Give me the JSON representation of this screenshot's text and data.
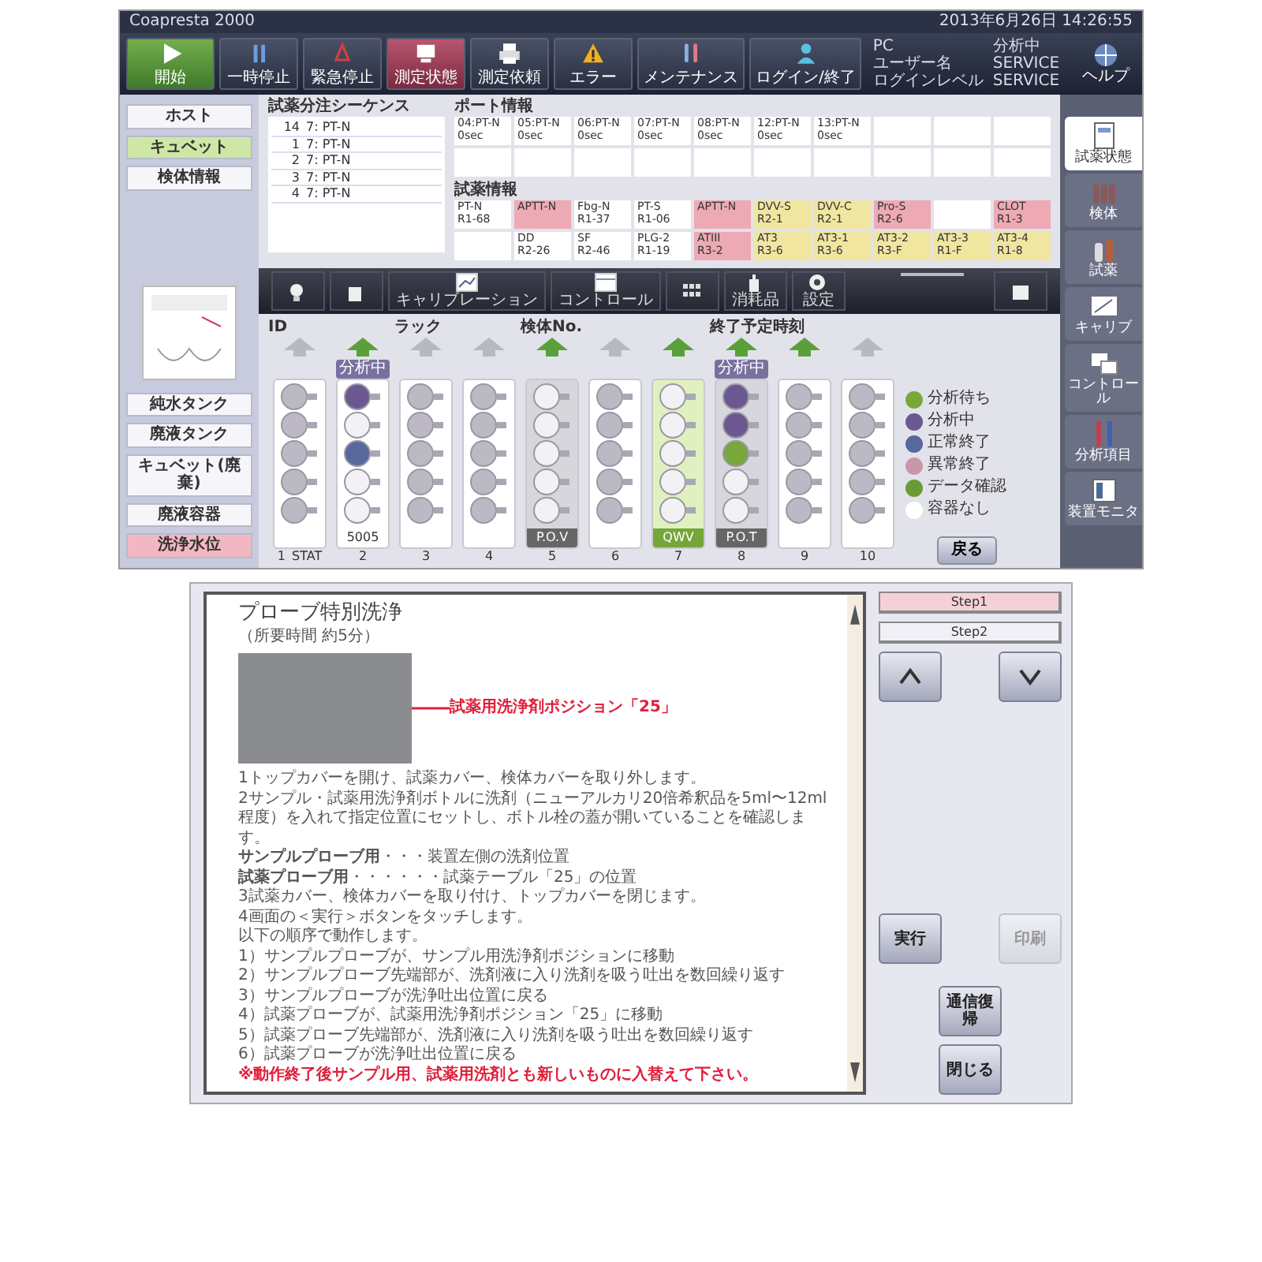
{
  "app": {
    "title": "Coapresta 2000",
    "datetime": "2013年6月26日 14:26:55"
  },
  "toolbar": [
    {
      "kind": "start",
      "label": "開始",
      "selected": false
    },
    {
      "kind": "normal",
      "label": "一時停止",
      "selected": false
    },
    {
      "kind": "normal",
      "label": "緊急停止",
      "selected": false
    },
    {
      "kind": "normal",
      "label": "測定状態",
      "selected": true
    },
    {
      "kind": "normal",
      "label": "測定依頼",
      "selected": false
    },
    {
      "kind": "normal",
      "label": "エラー",
      "selected": false
    },
    {
      "kind": "normal",
      "label": "メンテナンス",
      "selected": false
    },
    {
      "kind": "normal",
      "label": "ログイン/終了",
      "selected": false
    }
  ],
  "status": [
    {
      "label": "PC",
      "value": "分析中"
    },
    {
      "label": "ユーザー名",
      "value": "SERVICE"
    },
    {
      "label": "ログインレベル",
      "value": "SERVICE"
    }
  ],
  "help": "ヘルプ",
  "sidebar": {
    "top_buttons": [
      {
        "label": "ホスト",
        "selected": false
      },
      {
        "label": "キュベット",
        "selected": true
      },
      {
        "label": "検体情報",
        "selected": false
      }
    ],
    "bottom_buttons": [
      {
        "label": "純水タンク",
        "warning": false
      },
      {
        "label": "廃液タンク",
        "warning": false
      },
      {
        "label": "キュベット(廃棄)",
        "warning": false
      },
      {
        "label": "廃液容器",
        "warning": false
      },
      {
        "label": "洗浄水位",
        "warning": true
      }
    ]
  },
  "sequence": {
    "title": "試薬分注シーケンス",
    "rows": [
      {
        "no": "14",
        "item": "7: PT-N"
      },
      {
        "no": "1",
        "item": "7: PT-N"
      },
      {
        "no": "2",
        "item": "7: PT-N"
      },
      {
        "no": "3",
        "item": "7: PT-N"
      },
      {
        "no": "4",
        "item": "7: PT-N"
      }
    ]
  },
  "ports": {
    "title": "ポート情報",
    "cells": [
      {
        "name": "04:PT-N",
        "time": "0sec"
      },
      {
        "name": "05:PT-N",
        "time": "0sec"
      },
      {
        "name": "06:PT-N",
        "time": "0sec"
      },
      {
        "name": "07:PT-N",
        "time": "0sec"
      },
      {
        "name": "08:PT-N",
        "time": "0sec"
      },
      {
        "name": "12:PT-N",
        "time": "0sec"
      },
      {
        "name": "13:PT-N",
        "time": "0sec"
      }
    ]
  },
  "reagents": {
    "title": "試薬情報",
    "cells": [
      {
        "name": "PT-N",
        "pos": "R1-68",
        "color": "#ffffff"
      },
      {
        "name": "APTT-N",
        "color": "#eeaab4"
      },
      {
        "name": "Fbg-N",
        "pos": "R1-37",
        "color": "#ffffff"
      },
      {
        "name": "PT-S",
        "pos": "R1-06",
        "color": "#ffffff"
      },
      {
        "name": "APTT-N",
        "color": "#eeaab4"
      },
      {
        "name": "DVV-S",
        "pos": "R2-1",
        "color": "#f0e6a0"
      },
      {
        "name": "DVV-C",
        "pos": "R2-1",
        "color": "#f0e6a0"
      },
      {
        "name": "Pro-S",
        "pos": "R2-6",
        "color": "#eeaab4"
      },
      {
        "color": "#ffffff"
      },
      {
        "name": "CLOT",
        "pos": "R1-3",
        "color": "#eeaab4"
      },
      {
        "color": "#ffffff"
      },
      {
        "name": "DD",
        "pos": "R2-26",
        "color": "#ffffff"
      },
      {
        "name": "SF",
        "pos": "R2-46",
        "color": "#ffffff"
      },
      {
        "name": "PLG-2",
        "pos": "R1-19",
        "color": "#ffffff"
      },
      {
        "name": "ATIII",
        "pos": "R3-2",
        "color": "#eeaab4"
      },
      {
        "name": "AT3",
        "pos": "R3-6",
        "color": "#f0e6a0"
      },
      {
        "name": "AT3-1",
        "pos": "R3-6",
        "color": "#f0e6a0"
      },
      {
        "name": "AT3-2",
        "pos": "R3-F",
        "color": "#f0e6a0"
      },
      {
        "name": "AT3-3",
        "pos": "R1-F",
        "color": "#f0e6a0"
      },
      {
        "name": "AT3-4",
        "pos": "R1-8",
        "color": "#f0e6a0"
      }
    ]
  },
  "tools": [
    {
      "kind": "icon"
    },
    {
      "kind": "icon"
    },
    {
      "kind": "labeled",
      "label": "キャリブレーション"
    },
    {
      "kind": "labeled",
      "label": "コントロール"
    },
    {
      "kind": "icon"
    },
    {
      "kind": "labeled",
      "label": "消耗品"
    },
    {
      "kind": "labeled",
      "label": "設定"
    }
  ],
  "rack_header": [
    "ID",
    "ラック",
    "検体No.",
    "終了予定時刻"
  ],
  "racks": [
    {
      "number": "1",
      "tag": "STAT",
      "arrow_on": false,
      "kind": "empty",
      "cups": [
        {
          "color": "#bdb9c4"
        },
        {
          "color": "#bdb9c4"
        },
        {
          "color": "#bdb9c4"
        },
        {
          "color": "#bdb9c4"
        },
        {
          "color": "#bdb9c4"
        }
      ]
    },
    {
      "number": "2",
      "arrow_on": true,
      "badge": "分析中",
      "kind": "empty",
      "label": "5005",
      "cups": [
        {
          "color": "#6c5890"
        },
        {
          "color": "#f2f2f4"
        },
        {
          "color": "#56689c"
        },
        {
          "color": "#f2f2f4"
        },
        {
          "color": "#f2f2f4"
        }
      ]
    },
    {
      "number": "3",
      "arrow_on": false,
      "kind": "empty",
      "cups": [
        {
          "color": "#bdb9c4"
        },
        {
          "color": "#bdb9c4"
        },
        {
          "color": "#bdb9c4"
        },
        {
          "color": "#bdb9c4"
        },
        {
          "color": "#bdb9c4"
        }
      ]
    },
    {
      "number": "4",
      "arrow_on": false,
      "kind": "empty",
      "cups": [
        {
          "color": "#bdb9c4"
        },
        {
          "color": "#bdb9c4"
        },
        {
          "color": "#bdb9c4"
        },
        {
          "color": "#bdb9c4"
        },
        {
          "color": "#bdb9c4"
        }
      ]
    },
    {
      "number": "5",
      "arrow_on": true,
      "kind": "loaded",
      "label": "P.O.V",
      "cups": [
        {
          "color": "#f2f2f4"
        },
        {
          "color": "#f2f2f4"
        },
        {
          "color": "#f2f2f4"
        },
        {
          "color": "#f2f2f4"
        },
        {
          "color": "#f2f2f4"
        }
      ]
    },
    {
      "number": "6",
      "arrow_on": false,
      "kind": "empty",
      "cups": [
        {
          "color": "#bdb9c4"
        },
        {
          "color": "#bdb9c4"
        },
        {
          "color": "#bdb9c4"
        },
        {
          "color": "#bdb9c4"
        },
        {
          "color": "#bdb9c4"
        }
      ]
    },
    {
      "number": "7",
      "arrow_on": true,
      "kind": "highlight",
      "label": "QWV",
      "cups": [
        {
          "color": "#f2f2f4"
        },
        {
          "color": "#f2f2f4"
        },
        {
          "color": "#f2f2f4"
        },
        {
          "color": "#f2f2f4"
        },
        {
          "color": "#f2f2f4"
        }
      ]
    },
    {
      "number": "8",
      "arrow_on": true,
      "badge": "分析中",
      "kind": "loaded",
      "label": "P.O.T",
      "cups": [
        {
          "color": "#6c5890"
        },
        {
          "color": "#6c5890"
        },
        {
          "color": "#78a83c"
        },
        {
          "color": "#f2f2f4"
        },
        {
          "color": "#f2f2f4"
        }
      ]
    },
    {
      "number": "9",
      "arrow_on": true,
      "kind": "empty",
      "cups": [
        {
          "color": "#bdb9c4"
        },
        {
          "color": "#bdb9c4"
        },
        {
          "color": "#bdb9c4"
        },
        {
          "color": "#bdb9c4"
        },
        {
          "color": "#bdb9c4"
        }
      ]
    },
    {
      "number": "10",
      "arrow_on": false,
      "kind": "empty",
      "cups": [
        {
          "color": "#bdb9c4"
        },
        {
          "color": "#bdb9c4"
        },
        {
          "color": "#bdb9c4"
        },
        {
          "color": "#bdb9c4"
        },
        {
          "color": "#bdb9c4"
        }
      ]
    }
  ],
  "legend": [
    {
      "label": "分析待ち",
      "color": "#78a83c"
    },
    {
      "label": "分析中",
      "color": "#6c5890"
    },
    {
      "label": "正常終了",
      "color": "#56689c"
    },
    {
      "label": "異常終了",
      "color": "#c898a8"
    },
    {
      "label": "データ確認",
      "color": "#6a9c36"
    },
    {
      "label": "容器なし",
      "color": "#ffffff"
    }
  ],
  "back_button": "戻る",
  "side_tabs": [
    {
      "label": "試薬状態",
      "selected": true
    },
    {
      "label": "検体",
      "selected": false
    },
    {
      "label": "試薬",
      "selected": false
    },
    {
      "label": "キャリブ",
      "selected": false
    },
    {
      "label": "コントロール",
      "selected": false
    },
    {
      "label": "分析項目",
      "selected": false
    },
    {
      "label": "装置モニタ",
      "selected": false
    }
  ],
  "manual": {
    "title": "プローブ特別洗浄",
    "subtitle": "（所要時間 約5分）",
    "callout": "試薬用洗浄剤ポジション「25」",
    "lines": [
      {
        "kind": "normal",
        "text": "1トップカバーを開け、試薬カバー、検体カバーを取り外します。"
      },
      {
        "kind": "normal",
        "text": "2サンプル・試薬用洗浄剤ボトルに洗剤（ニューアルカリ20倍希釈品を5ml〜12ml程度）を入れて指定位置にセットし、ボトル栓の蓋が開いていることを確認します。"
      },
      {
        "kind": "normal",
        "text": "**サンプルプローブ用**・・・装置左側の洗剤位置"
      },
      {
        "kind": "normal",
        "text": "**試薬プローブ用**・・・・・・試薬テーブル「25」の位置"
      },
      {
        "kind": "normal",
        "text": "3試薬カバー、検体カバーを取り付け、トップカバーを閉じます。"
      },
      {
        "kind": "normal",
        "text": "4画面の＜実行＞ボタンをタッチします。"
      },
      {
        "kind": "normal",
        "text": "以下の順序で動作します。"
      },
      {
        "kind": "normal",
        "text": "1）サンプルプローブが、サンプル用洗浄剤ポジションに移動"
      },
      {
        "kind": "normal",
        "text": "2）サンプルプローブ先端部が、洗剤液に入り洗剤を吸う吐出を数回繰り返す"
      },
      {
        "kind": "normal",
        "text": "3）サンプルプローブが洗浄吐出位置に戻る"
      },
      {
        "kind": "normal",
        "text": "4）試薬プローブが、試薬用洗浄剤ポジション「25」に移動"
      },
      {
        "kind": "normal",
        "text": "5）試薬プローブ先端部が、洗剤液に入り洗剤を吸う吐出を数回繰り返す"
      },
      {
        "kind": "normal",
        "text": "6）試薬プローブが洗浄吐出位置に戻る"
      },
      {
        "kind": "warning",
        "text": "※動作終了後サンプル用、試薬用洗剤とも新しいものに入替えて下さい。"
      }
    ],
    "steps": [
      {
        "label": "Step1",
        "selected": true
      },
      {
        "label": "Step2",
        "selected": false
      }
    ],
    "buttons": [
      {
        "label": "実行",
        "disabled": false
      },
      {
        "label": "印刷",
        "disabled": true
      }
    ],
    "bottom_buttons": [
      {
        "label": "通信復帰"
      },
      {
        "label": "閉じる"
      }
    ]
  }
}
